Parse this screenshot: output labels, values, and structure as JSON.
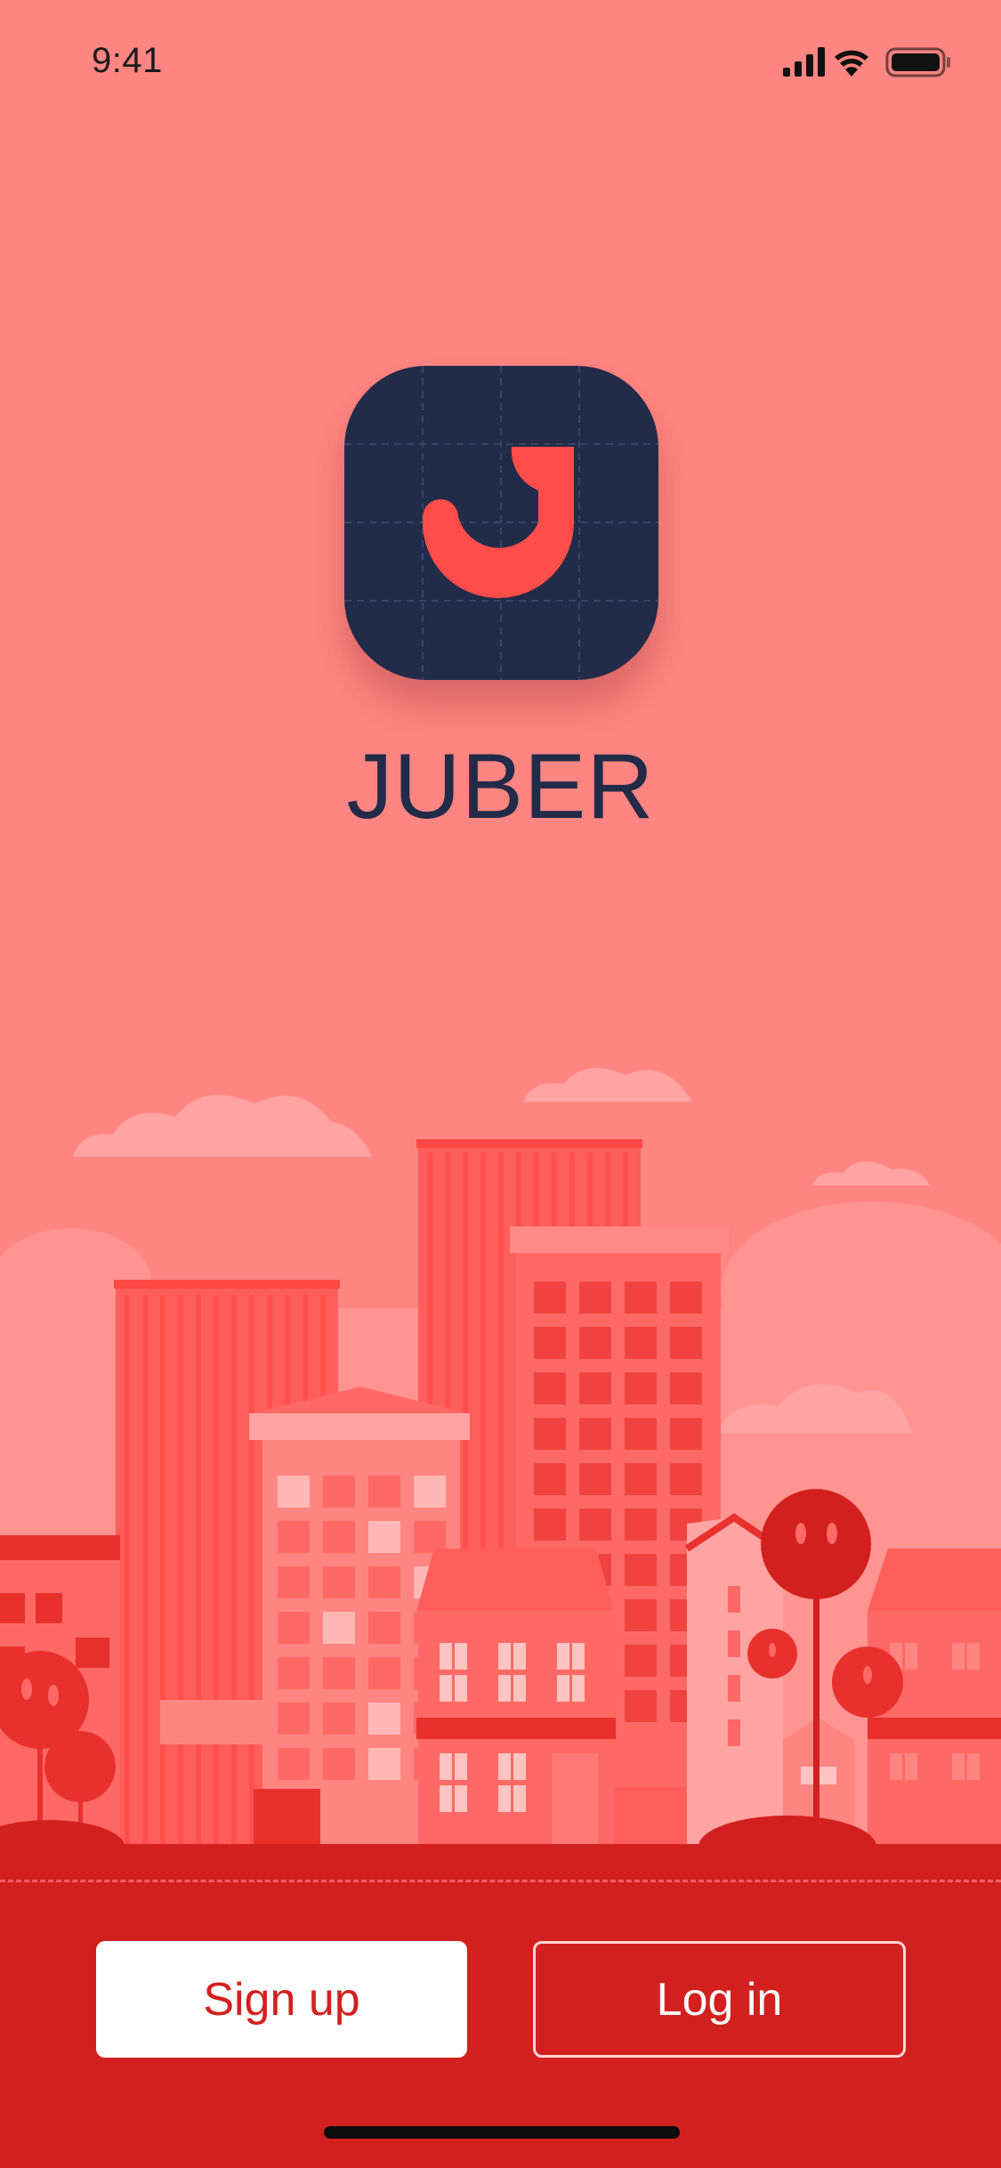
{
  "status_bar": {
    "time": "9:41",
    "icons": [
      "cellular-signal-icon",
      "wifi-icon",
      "battery-icon"
    ]
  },
  "app": {
    "logo_icon": "juber-j-logo-icon",
    "name": "JUBER"
  },
  "actions": {
    "signup_label": "Sign up",
    "login_label": "Log in"
  },
  "colors": {
    "background": "#ff8582",
    "brand_dark": "#222b48",
    "brand_red": "#d2201e",
    "logo_accent": "#ff4d4a"
  }
}
